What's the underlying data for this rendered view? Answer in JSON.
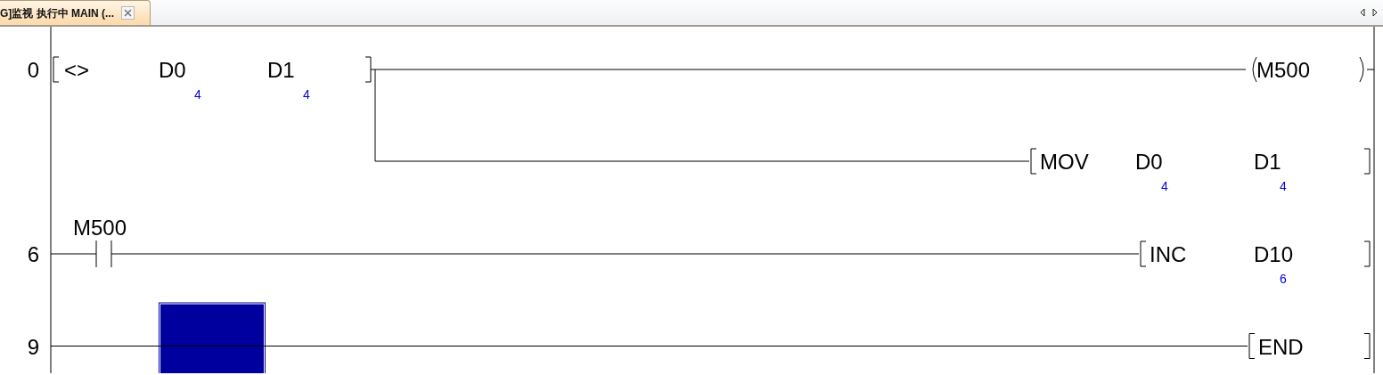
{
  "tab": {
    "title": "G]监视 执行中 MAIN (...",
    "closable": true
  },
  "rungs": [
    {
      "step": "0",
      "contacts": [
        {
          "kind": "compare",
          "operator": "<>",
          "operands": [
            {
              "device": "D0",
              "value": "4"
            },
            {
              "device": "D1",
              "value": "4"
            }
          ]
        }
      ],
      "outputs": [
        {
          "kind": "coil",
          "device": "M500"
        },
        {
          "kind": "instruction",
          "op": "MOV",
          "operands": [
            {
              "device": "D0",
              "value": "4"
            },
            {
              "device": "D1",
              "value": "4"
            }
          ]
        }
      ]
    },
    {
      "step": "6",
      "contacts": [
        {
          "kind": "contact",
          "device": "M500"
        }
      ],
      "outputs": [
        {
          "kind": "instruction",
          "op": "INC",
          "operands": [
            {
              "device": "D10",
              "value": "6"
            }
          ]
        }
      ]
    },
    {
      "step": "9",
      "cursor": true,
      "outputs": [
        {
          "kind": "instruction",
          "op": "END"
        }
      ]
    }
  ]
}
